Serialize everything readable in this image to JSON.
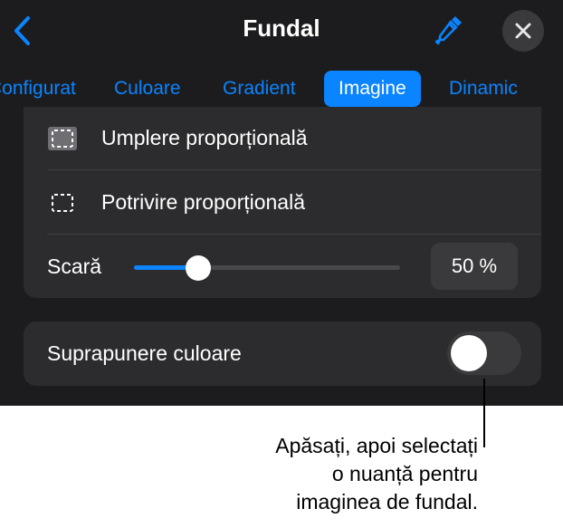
{
  "header": {
    "title": "Fundal",
    "back_icon": "chevron-left-icon",
    "eyedropper_icon": "eyedropper-icon",
    "close_icon": "close-icon"
  },
  "tabs": [
    {
      "label": "Configurat",
      "active": false
    },
    {
      "label": "Culoare",
      "active": false
    },
    {
      "label": "Gradient",
      "active": false
    },
    {
      "label": "Imagine",
      "active": true
    },
    {
      "label": "Dinamic",
      "active": false
    }
  ],
  "image_options": {
    "fill": {
      "label": "Umplere proporțională",
      "icon": "dashed-square-filled-icon"
    },
    "fit": {
      "label": "Potrivire proporțională",
      "icon": "dashed-square-icon"
    }
  },
  "scale": {
    "label": "Scară",
    "value_text": "50 %",
    "value": 0.24
  },
  "color_overlay": {
    "label": "Suprapunere culoare",
    "enabled": false
  },
  "callout": {
    "lines": [
      "Apăsați, apoi selectați",
      "o nuanță pentru",
      "imaginea de fundal."
    ]
  },
  "colors": {
    "accent": "#0a84ff",
    "panel_bg": "#1c1c1e",
    "group_bg": "#2c2c2e"
  }
}
